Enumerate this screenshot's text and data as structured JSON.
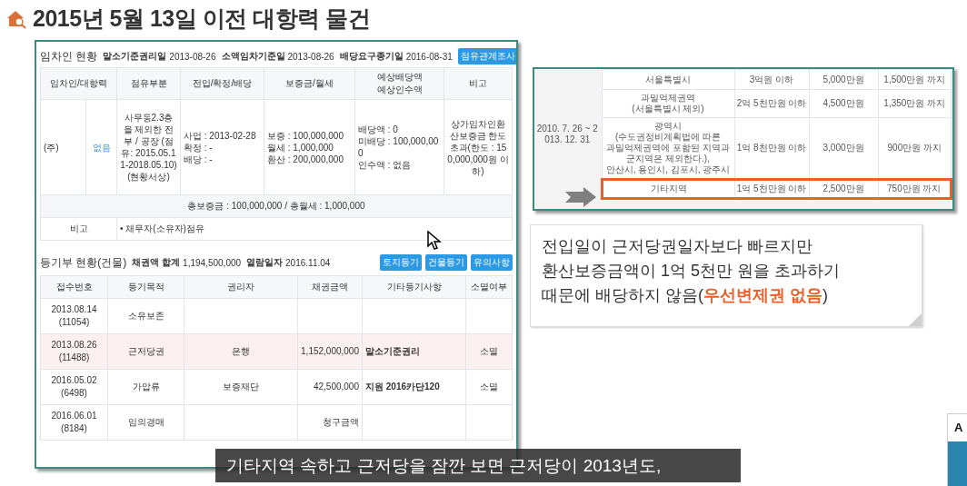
{
  "title": "2015년 5월 13일 이전 대항력 물건",
  "tenant_panel": {
    "title": "임차인 현황",
    "meta": [
      {
        "label": "말소기준권리일",
        "value": "2013-08-26"
      },
      {
        "label": "소액임차기준일",
        "value": "2013-08-26"
      },
      {
        "label": "배당요구종기일",
        "value": "2016-08-31"
      }
    ],
    "button": "점유관계조사",
    "columns": [
      [
        "임차인/대항력"
      ],
      [
        "점유부분"
      ],
      [
        "전입/확정/배당"
      ],
      [
        "보증금/월세"
      ],
      [
        "예상배당액",
        "예상인수액"
      ],
      [
        "비고"
      ]
    ],
    "row": {
      "tenant": "(주)",
      "opposability": "없음",
      "occupancy": "사무동2.3층을 제외한 전부 / 공장 (점유: 2015.05.11-2018.05.10) (현황서상)",
      "dates": [
        "사업 : 2013-02-28",
        "확정 : -",
        "배당 : -"
      ],
      "deposit": [
        "보증 : 100,000,000",
        "월세 : 1,000,000",
        "환산 : 200,000,000"
      ],
      "dividend": [
        "배당액 : 0",
        "미배당 : 100,000,000",
        "인수액 : 없음"
      ],
      "remark": "상가임차인환산보증금 한도초과(한도 : 150,000,000원 이하)"
    },
    "total": "총보증금 : 100,000,000  /  총월세 : 1,000,000",
    "note_label": "비고",
    "note": "• 채무자(소유자)점유"
  },
  "registry": {
    "title": "등기부 현황(건물)",
    "meta": [
      {
        "label": "채권액 합계",
        "value": "1,194,500,000"
      },
      {
        "label": "열람일자",
        "value": "2016.11.04"
      }
    ],
    "buttons": [
      "토지등기",
      "건물등기",
      "유의사항"
    ],
    "columns": [
      "접수번호",
      "등기목적",
      "권리자",
      "채권금액",
      "기타등기사항",
      "소멸여부"
    ],
    "rows": [
      {
        "receipt": [
          "2013.08.14",
          "(11054)"
        ],
        "purpose": "소유보존",
        "holder": "",
        "amount": "",
        "other": "",
        "extinct": "",
        "highlighted": false
      },
      {
        "receipt": [
          "2013.08.26",
          "(11488)"
        ],
        "purpose": "근저당권",
        "holder": "은행",
        "amount": "1,152,000,000",
        "other": "말소기준권리",
        "extinct": "소멸",
        "highlighted": true
      },
      {
        "receipt": [
          "2016.05.02",
          "(6498)"
        ],
        "purpose": "가압류",
        "holder": "보증재단",
        "amount": "42,500,000",
        "other": "지원 2016카단120",
        "extinct": "소멸",
        "highlighted": false
      },
      {
        "receipt": [
          "2016.06.01",
          "(8184)"
        ],
        "purpose": "임의경매",
        "holder": "",
        "amount": "청구금액",
        "other": "",
        "extinct": "",
        "highlighted": false
      }
    ]
  },
  "limit_table": {
    "period": "2010. 7. 26 ~ 2013. 12. 31",
    "rows": [
      {
        "region": [
          "서울특별시"
        ],
        "range": "3억원 이하",
        "limit": "5,000만원",
        "priority": "1,500만원 까지",
        "highlighted": false
      },
      {
        "region": [
          "과밀억제권역",
          "(서울특별시 제외)"
        ],
        "range": "2억 5천만원 이하",
        "limit": "4,500만원",
        "priority": "1,350만원 까지",
        "highlighted": false
      },
      {
        "region": [
          "광역시",
          "(수도권정비계획법에 따른",
          "과밀억제권역에 포함된 지역과",
          "군지역은 제외한다.),",
          "안산시, 용인시, 김포시, 광주시"
        ],
        "range": "1억 8천만원 이하",
        "limit": "3,000만원",
        "priority": "900만원 까지",
        "highlighted": false
      },
      {
        "region": [
          "기타지역"
        ],
        "range": "1억 5천만원 이하",
        "limit": "2,500만원",
        "priority": "750만원 까지",
        "highlighted": true
      }
    ]
  },
  "callout": [
    "전입일이 근저당권일자보다 빠르지만",
    "환산보증금액이 1억 5천만 원을 초과하기",
    "때문에 배당하지 않음(**우선변제권 없음**)"
  ],
  "subtitle": "기타지역 속하고 근저당을 잠깐 보면 근저당이 2013년도,",
  "corner_logo": "A"
}
